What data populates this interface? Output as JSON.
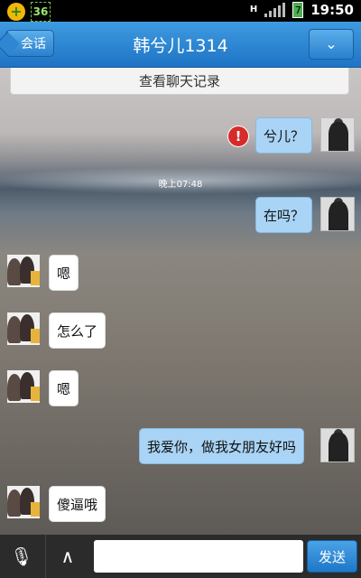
{
  "status_bar": {
    "badge_number": "36",
    "network_type": "H",
    "battery_level": "7",
    "time": "19:50"
  },
  "title_bar": {
    "back_label": "会话",
    "title": "韩兮儿1314",
    "more_icon": "chevron-down-icon"
  },
  "history_button": "查看聊天记录",
  "messages": [
    {
      "from": "me",
      "text": "兮儿？",
      "send_failed": true
    },
    {
      "type": "timestamp",
      "text": "晚上07:48"
    },
    {
      "from": "me",
      "text": "在吗？"
    },
    {
      "from": "her",
      "text": "嗯"
    },
    {
      "from": "her",
      "text": "怎么了"
    },
    {
      "from": "her",
      "text": "嗯"
    },
    {
      "from": "me",
      "text": "我爱你，做我女朋友好吗"
    },
    {
      "from": "her",
      "text": "傻逼哦"
    }
  ],
  "input_bar": {
    "mic_icon": "microphone-icon",
    "expand_icon": "chevron-up-icon",
    "text_value": "",
    "send_label": "发送"
  },
  "colors": {
    "title_bar": "#2a86d4",
    "outgoing_bubble": "#a9d4f5",
    "incoming_bubble": "#ffffff",
    "error": "#d62b2b"
  }
}
